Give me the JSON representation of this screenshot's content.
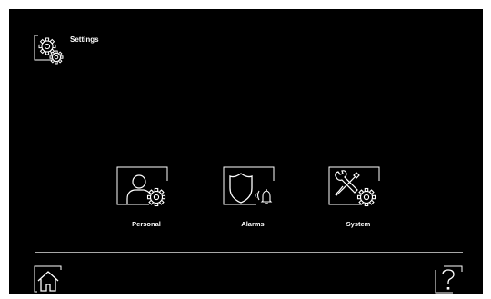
{
  "header": {
    "title": "Settings",
    "icon": "settings-gear-icon"
  },
  "tiles": [
    {
      "label": "Personal",
      "icon": "person-gear-icon"
    },
    {
      "label": "Alarms",
      "icon": "shield-bell-icon"
    },
    {
      "label": "System",
      "icon": "tools-gear-icon"
    }
  ],
  "footer": {
    "home_icon": "home-icon",
    "help_icon": "help-icon"
  },
  "colors": {
    "background": "#000000",
    "foreground": "#ffffff",
    "divider": "#a8a8a8"
  }
}
